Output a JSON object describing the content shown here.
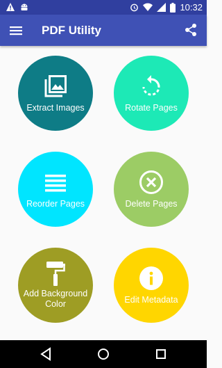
{
  "status_bar": {
    "time": "10:32",
    "left_icons": [
      "warning-icon",
      "android-icon"
    ],
    "right_icons": [
      "alarm-icon",
      "wifi-icon",
      "signal-icon",
      "battery-icon"
    ]
  },
  "toolbar": {
    "title": "PDF Utility",
    "menu_icon": "hamburger-menu-icon",
    "share_icon": "share-icon",
    "color": "#3f51b5",
    "status_color": "#303f9f"
  },
  "tiles": [
    {
      "label": "Extract Images",
      "icon": "image-stack-icon",
      "color": "#0e7c86"
    },
    {
      "label": "Rotate Pages",
      "icon": "rotate-icon",
      "color": "#1de9b6"
    },
    {
      "label": "Reorder Pages",
      "icon": "list-icon",
      "color": "#00e5ff"
    },
    {
      "label": "Delete Pages",
      "icon": "close-circle-icon",
      "color": "#9ccc65"
    },
    {
      "label": "Add Background Color",
      "icon": "paint-roller-icon",
      "color": "#9e9d24"
    },
    {
      "label": "Edit Metadata",
      "icon": "info-icon",
      "color": "#ffd600"
    }
  ],
  "nav_bar": {
    "buttons": [
      "back-icon",
      "home-icon",
      "recents-icon"
    ]
  }
}
